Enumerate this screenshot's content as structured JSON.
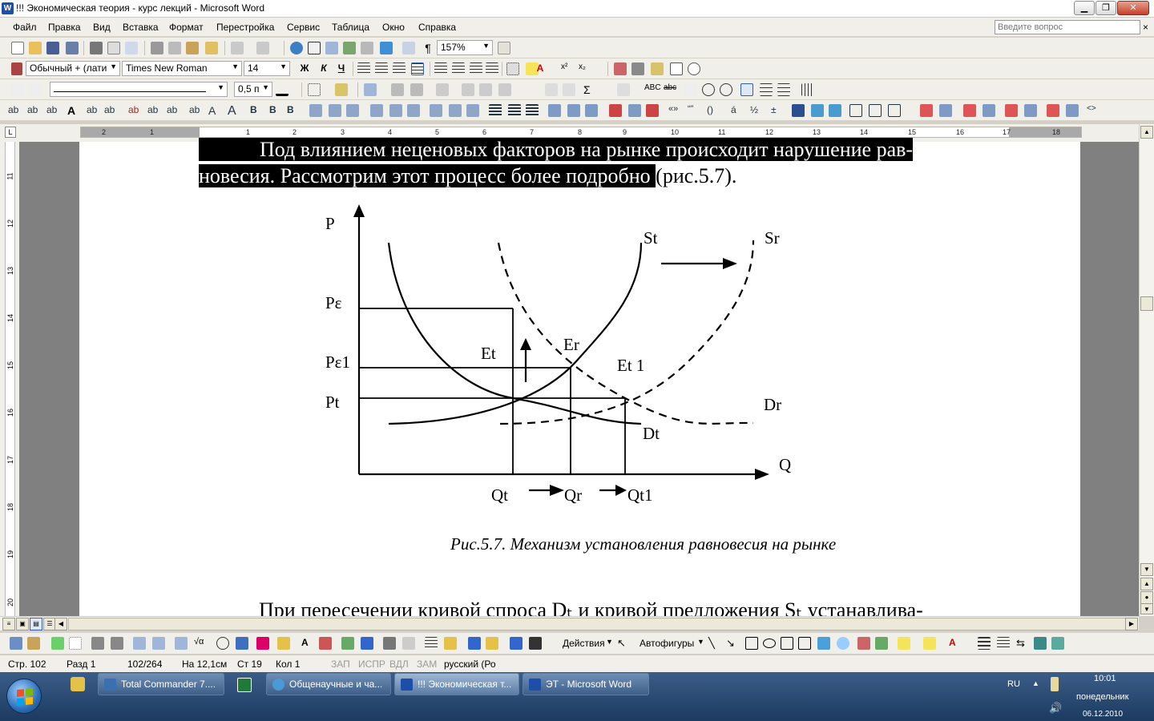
{
  "window": {
    "title": "!!! Экономическая теория - курс лекций - Microsoft Word",
    "app_icon": "W",
    "buttons": [
      "minimize-icon",
      "restore-icon",
      "close-icon"
    ]
  },
  "menubar": {
    "items": [
      "Файл",
      "Правка",
      "Вид",
      "Вставка",
      "Формат",
      "Перестройка",
      "Сервис",
      "Таблица",
      "Окно",
      "Справка"
    ],
    "help_placeholder": "Введите вопрос",
    "close": "×"
  },
  "toolbar_standard": {
    "zoom": "157%"
  },
  "toolbar_formatting": {
    "style": "Обычный + (лати",
    "font": "Times New Roman",
    "size": "14",
    "bold": "Ж",
    "italic": "К",
    "underline": "Ч"
  },
  "toolbar_table": {
    "line_weight": "0,5 п"
  },
  "ruler": {
    "labels": [
      "2",
      "1",
      "1",
      "2",
      "3",
      "4",
      "5",
      "6",
      "7",
      "8",
      "9",
      "10",
      "11",
      "12",
      "13",
      "14",
      "15",
      "16",
      "17",
      "18"
    ],
    "corner": "L",
    "vertical_labels": [
      "11",
      "12",
      "13",
      "14",
      "15",
      "16",
      "17",
      "18",
      "19",
      "20"
    ]
  },
  "document": {
    "para1_line1_highlight": "Под влиянием неценовых факторов на рынке происходит нарушение рав-",
    "para1_line2_highlight": "новесия. Рассмотрим этот процесс более подробно ",
    "para1_line2_rest": "(рис.5.7).",
    "caption": "Рис.5.7. Механизм установления равновесия на рынке",
    "para2_line1": "При пересечении кривой спроса Dₜ и кривой предложения Sₜ устанавлива-"
  },
  "figure": {
    "axis_p": "P",
    "axis_q": "Q",
    "p_eps": "Pε",
    "p_eps1": "Pε1",
    "p_t": "Pt",
    "q_t": "Qt",
    "q_r": "Qr",
    "q_t1": "Qt1",
    "e_t": "Et",
    "e_r": "Er",
    "e_t1": "Et 1",
    "s_t": "St",
    "s_r": "Sr",
    "d_t": "Dt",
    "d_r": "Dr"
  },
  "drawbar": {
    "actions": "Действия",
    "autoshapes": "Автофигуры"
  },
  "statusbar": {
    "page": "Стр. 102",
    "section": "Разд 1",
    "pages": "102/264",
    "at": "На 12,1см",
    "line": "Ст 19",
    "col": "Кол 1",
    "rec": "ЗАП",
    "trk": "ИСПР",
    "ext": "ВДЛ",
    "ovr": "ЗАМ",
    "lang": "русский (Ро"
  },
  "taskbar": {
    "tasks": [
      "Total Commander 7....",
      "Общенаучные и ча...",
      "!!! Экономическая т...",
      "ЭТ - Microsoft Word"
    ],
    "lang": "RU",
    "time": "10:01",
    "day": "понедельник",
    "date": "06.12.2010"
  },
  "colors": {
    "highlight": "#000000",
    "taskbar": "#2b4a73",
    "page": "#ffffff",
    "workspace": "#808080"
  }
}
